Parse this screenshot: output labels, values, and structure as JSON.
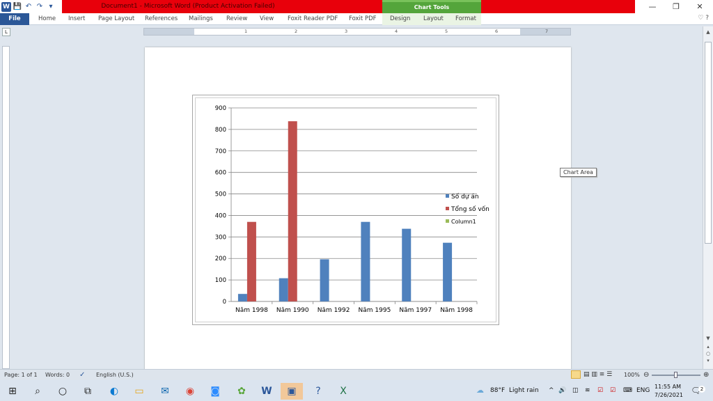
{
  "titlebar": {
    "doc_title": "Document1 - Microsoft Word (Product Activation Failed)",
    "context_tab": "Chart Tools",
    "minimize": "—",
    "restore": "❐",
    "close": "✕"
  },
  "qat": {
    "word_logo": "W",
    "save": "💾",
    "undo": "↶",
    "redo": "↷",
    "customize": "▾"
  },
  "ribbon": {
    "tabs": [
      "File",
      "Home",
      "Insert",
      "Page Layout",
      "References",
      "Mailings",
      "Review",
      "View",
      "Foxit Reader PDF",
      "Foxit PDF",
      "Design",
      "Layout",
      "Format"
    ],
    "right_glyphs": "♡ ?"
  },
  "ruler": {
    "corner": "L",
    "numbers": [
      "1",
      "1",
      "2",
      "3",
      "4",
      "5",
      "6",
      "7"
    ]
  },
  "tooltip": "Chart Area",
  "statusbar": {
    "page": "Page: 1 of 1",
    "words": "Words: 0",
    "language": "English (U.S.)",
    "zoom": "100%",
    "zoom_level_percent": 100
  },
  "taskbar": {
    "weather_temp": "88°F",
    "weather_text": "Light rain",
    "lang": "ENG",
    "time": "11:55 AM",
    "date": "7/26/2021",
    "notif_count": "2"
  },
  "chart_data": {
    "type": "bar",
    "categories": [
      "Năm 1998",
      "Năm 1990",
      "Năm 1992",
      "Năm 1995",
      "Năm 1997",
      "Năm 1998"
    ],
    "series": [
      {
        "name": "Số dự án",
        "color": "#4f81bd",
        "values": [
          35,
          108,
          196,
          370,
          338,
          273
        ]
      },
      {
        "name": "Tổng số vốn",
        "color": "#c0504d",
        "values": [
          370,
          838,
          null,
          null,
          null,
          null
        ]
      },
      {
        "name": "Column1",
        "color": "#9bbb59",
        "values": [
          null,
          null,
          null,
          null,
          null,
          null
        ]
      }
    ],
    "ylim": [
      0,
      900
    ],
    "yticks": [
      0,
      100,
      200,
      300,
      400,
      500,
      600,
      700,
      800,
      900
    ],
    "grid": true,
    "legend": "right"
  }
}
